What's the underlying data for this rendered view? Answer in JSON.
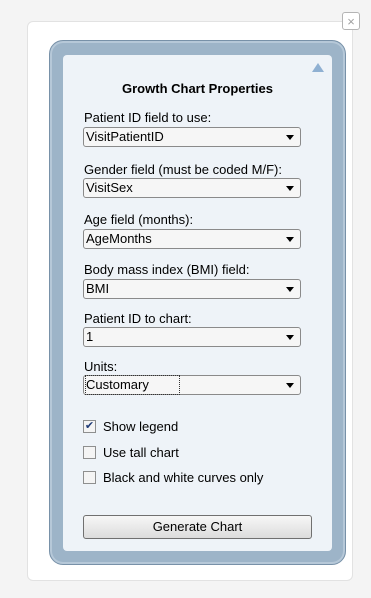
{
  "panel": {
    "title": "Growth Chart Properties",
    "close_glyph": "×",
    "fields": [
      {
        "label": "Patient ID field to use:",
        "value": "VisitPatientID"
      },
      {
        "label": "Gender field (must be coded M/F):",
        "value": "VisitSex"
      },
      {
        "label": "Age field (months):",
        "value": "AgeMonths"
      },
      {
        "label": "Body mass index (BMI) field:",
        "value": "BMI"
      },
      {
        "label": "Patient ID to chart:",
        "value": "1"
      },
      {
        "label": "Units:",
        "value": "Customary"
      }
    ],
    "checkboxes": [
      {
        "label": "Show legend",
        "checked": true
      },
      {
        "label": "Use tall chart",
        "checked": false
      },
      {
        "label": "Black and white curves only",
        "checked": false
      }
    ],
    "generate_label": "Generate Chart"
  },
  "icons": {
    "close": "close-icon",
    "collapse": "collapse-arrow-icon",
    "dropdown": "chevron-down-icon",
    "check": "checkmark-icon"
  },
  "colors": {
    "frame": "#9db4c8",
    "panel_bg": "#eef3f8",
    "arrow": "#8fb0d2"
  }
}
